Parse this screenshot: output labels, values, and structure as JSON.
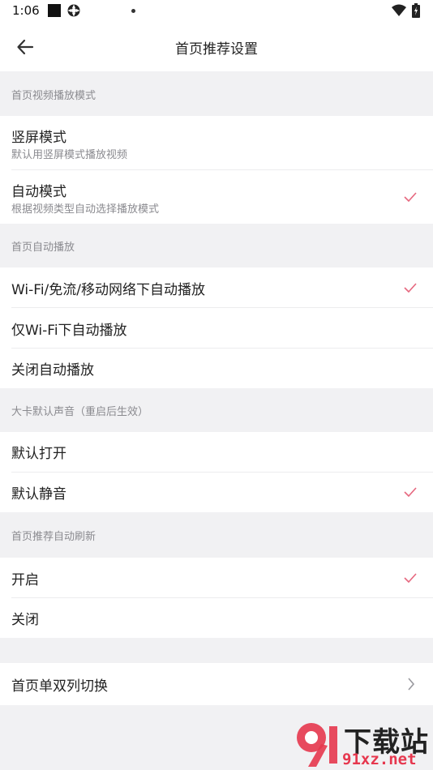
{
  "status_bar": {
    "time": "1:06"
  },
  "nav": {
    "title": "首页推荐设置"
  },
  "sections": [
    {
      "header": "首页视频播放模式",
      "options": [
        {
          "title": "竖屏模式",
          "subtitle": "默认用竖屏模式播放视频",
          "checked": false
        },
        {
          "title": "自动模式",
          "subtitle": "根据视频类型自动选择播放模式",
          "checked": true
        }
      ]
    },
    {
      "header": "首页自动播放",
      "options": [
        {
          "title": "Wi-Fi/免流/移动网络下自动播放",
          "checked": true
        },
        {
          "title": "仅Wi-Fi下自动播放",
          "checked": false
        },
        {
          "title": "关闭自动播放",
          "checked": false
        }
      ]
    },
    {
      "header": "大卡默认声音（重启后生效）",
      "options": [
        {
          "title": "默认打开",
          "checked": false
        },
        {
          "title": "默认静音",
          "checked": true
        }
      ]
    },
    {
      "header": "首页推荐自动刷新",
      "options": [
        {
          "title": "开启",
          "checked": true
        },
        {
          "title": "关闭",
          "checked": false
        }
      ]
    }
  ],
  "layout_switch": {
    "title": "首页单双列切换"
  },
  "watermark": {
    "text_cn": "下载站",
    "text_url": "91xz.net",
    "logo_mark": "91"
  },
  "colors": {
    "accent": "#e6687f",
    "background": "#f1f1f3",
    "row": "#ffffff"
  }
}
